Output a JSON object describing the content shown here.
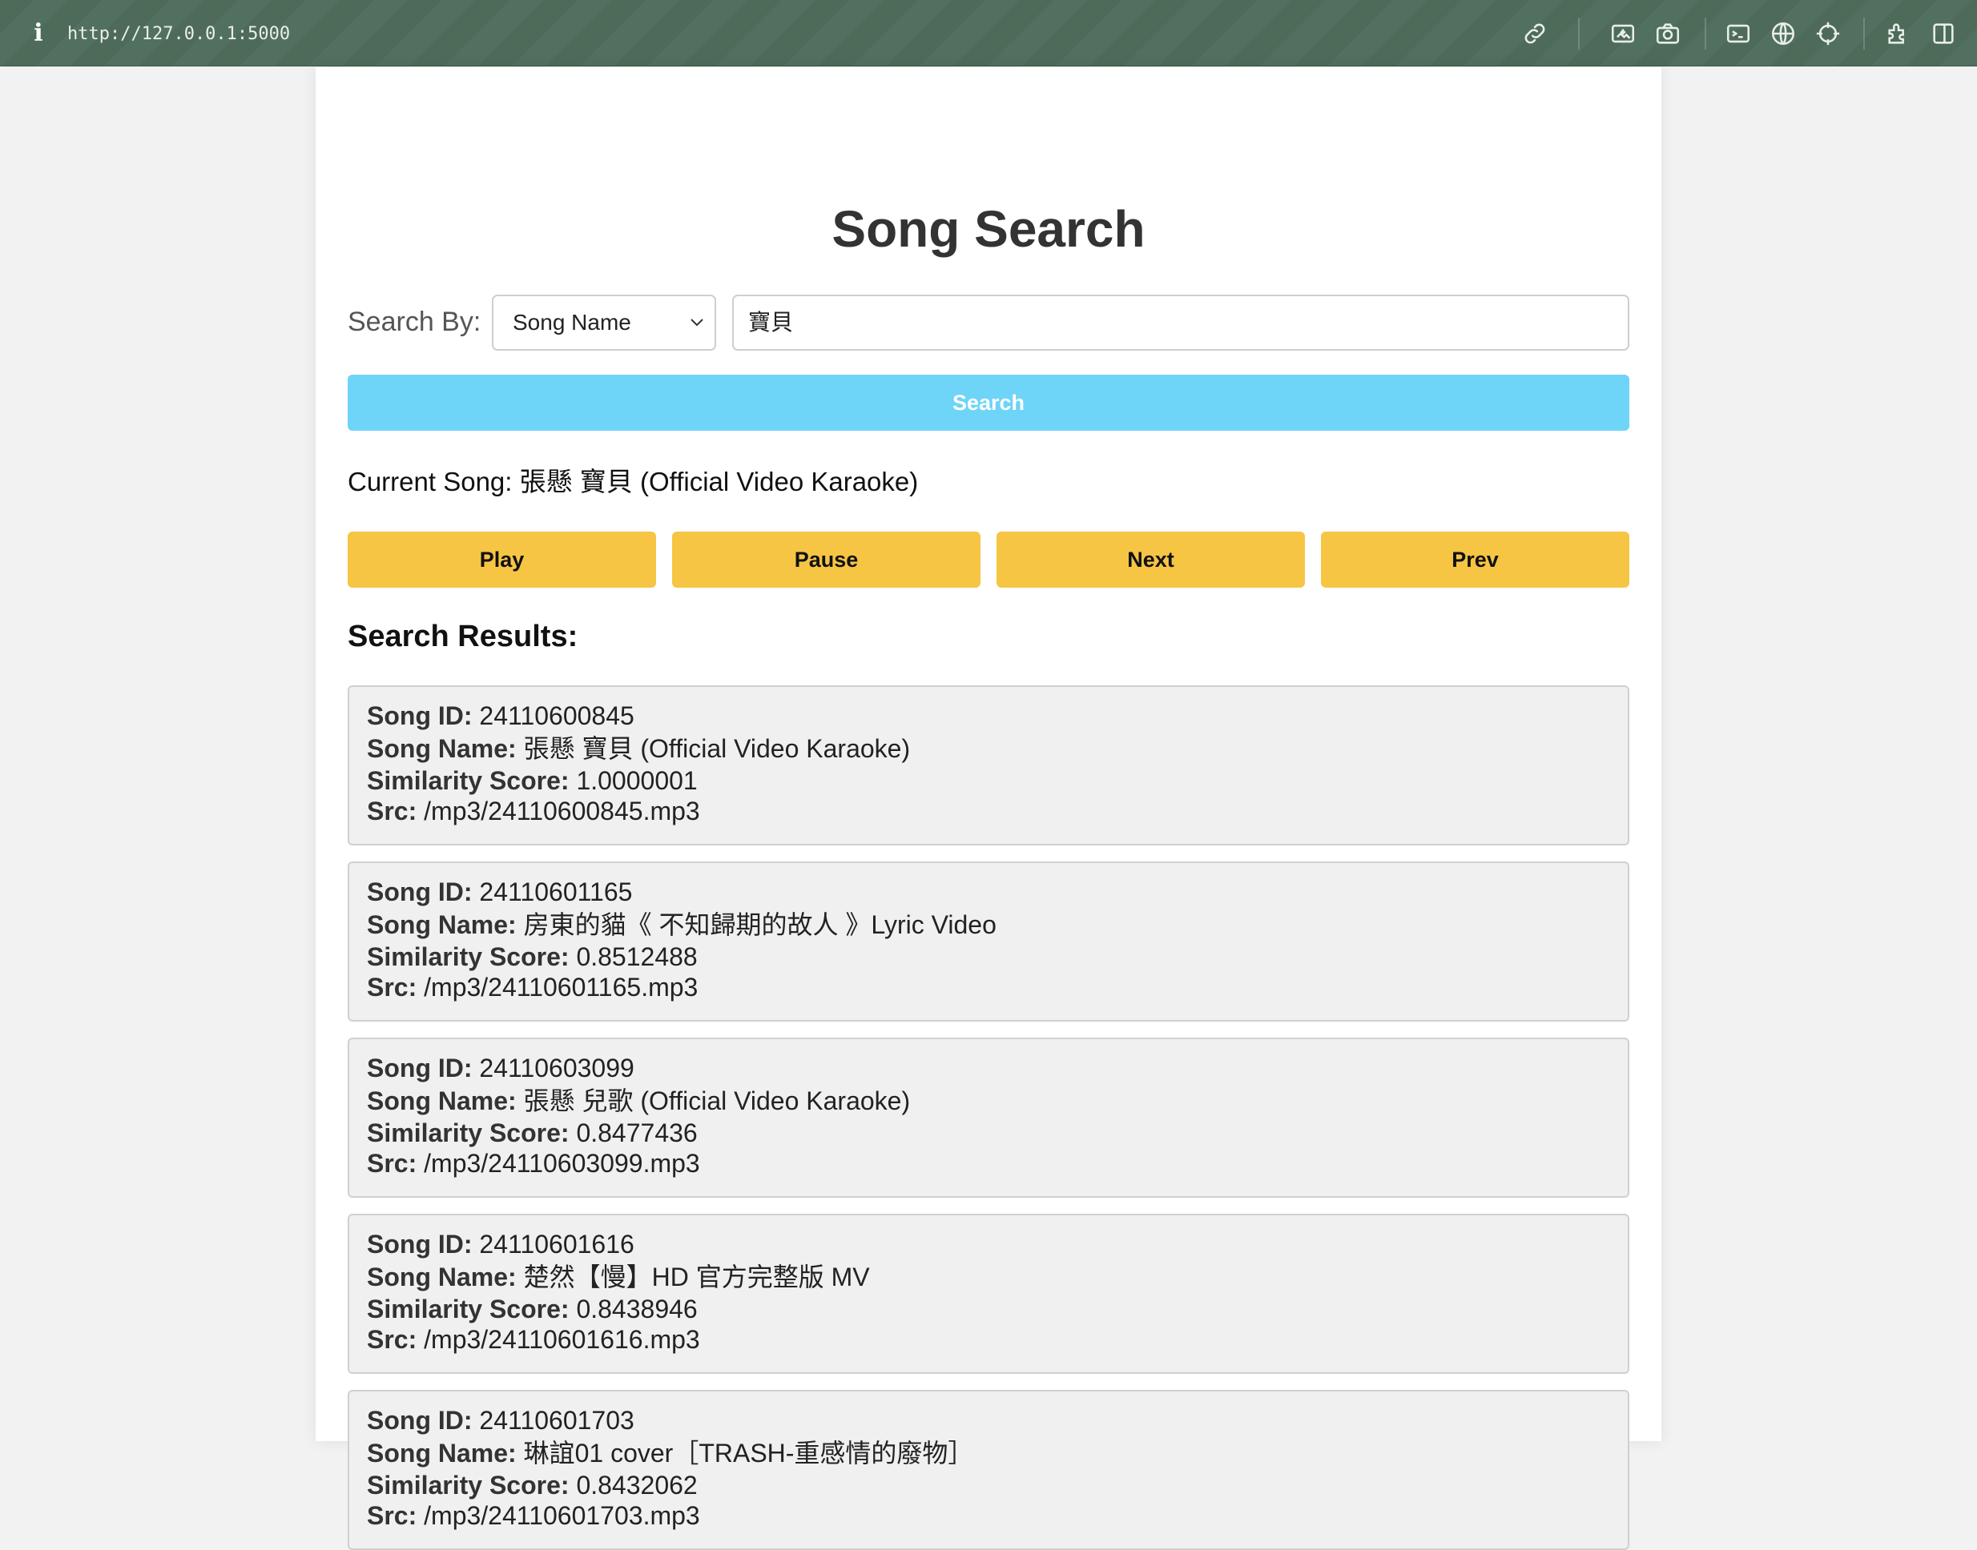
{
  "browser": {
    "info_icon": "i",
    "url": "http://127.0.0.1:5000",
    "toolbar_icons": [
      "link-icon",
      "image-screenshot-icon",
      "camera-icon",
      "terminal-icon",
      "globe-icon",
      "crosshair-icon",
      "extensions-icon",
      "sidebar-icon"
    ]
  },
  "page": {
    "title": "Song Search",
    "search_by_label": "Search By:",
    "search_by_selected": "Song Name",
    "search_query": "寶貝",
    "search_button": "Search",
    "current_song_label": "Current Song:",
    "current_song": "張懸 寶貝 (Official Video Karaoke)",
    "controls": {
      "play": "Play",
      "pause": "Pause",
      "next": "Next",
      "prev": "Prev"
    },
    "results_title": "Search Results:",
    "field_labels": {
      "id": "Song ID:",
      "name": "Song Name:",
      "score": "Similarity Score:",
      "src": "Src:"
    },
    "results": [
      {
        "id": "24110600845",
        "name": "張懸 寶貝 (Official Video Karaoke)",
        "score": "1.0000001",
        "src": "/mp3/24110600845.mp3"
      },
      {
        "id": "24110601165",
        "name": "房東的貓《 不知歸期的故人 》Lyric Video",
        "score": "0.8512488",
        "src": "/mp3/24110601165.mp3"
      },
      {
        "id": "24110603099",
        "name": "張懸 兒歌 (Official Video Karaoke)",
        "score": "0.8477436",
        "src": "/mp3/24110603099.mp3"
      },
      {
        "id": "24110601616",
        "name": "楚然【慢】HD 官方完整版 MV",
        "score": "0.8438946",
        "src": "/mp3/24110601616.mp3"
      },
      {
        "id": "24110601703",
        "name": "琳誼01 cover［TRASH-重感情的廢物］",
        "score": "0.8432062",
        "src": "/mp3/24110601703.mp3"
      }
    ]
  },
  "colors": {
    "topbar": "#4e6b5a",
    "search_button": "#6ed4f8",
    "control_button": "#f6c544",
    "result_card": "#f0f0f0"
  }
}
